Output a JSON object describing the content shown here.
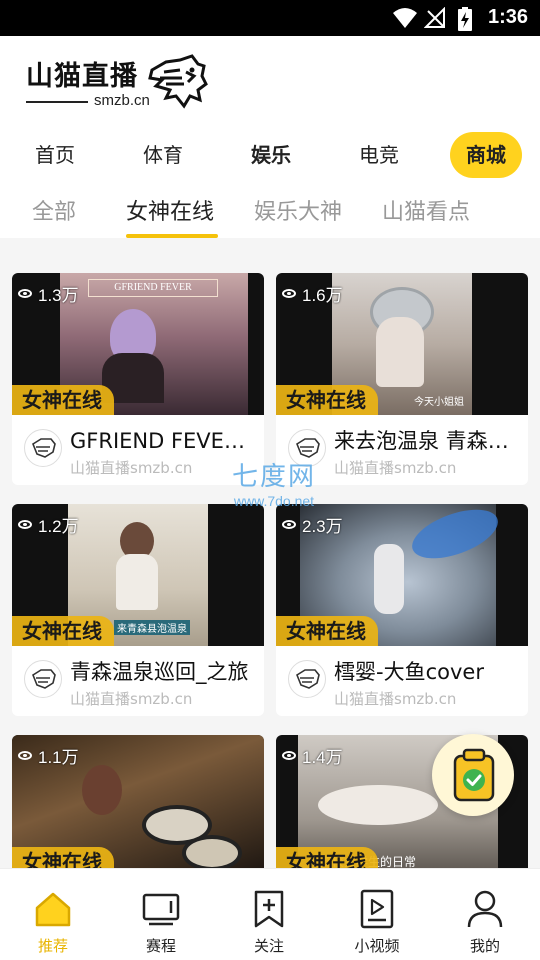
{
  "status_bar": {
    "time": "1:36"
  },
  "header": {
    "logo_cn": "山猫直播",
    "logo_en": "smzb.cn"
  },
  "main_tabs": [
    {
      "label": "首页"
    },
    {
      "label": "体育"
    },
    {
      "label": "娱乐"
    },
    {
      "label": "电竞"
    },
    {
      "label": "商城"
    }
  ],
  "sub_tabs": [
    {
      "label": "全部"
    },
    {
      "label": "女神在线"
    },
    {
      "label": "娱乐大神"
    },
    {
      "label": "山猫看点"
    }
  ],
  "cards": [
    {
      "views": "1.3万",
      "tag": "女神在线",
      "title": "GFRIEND FEVER舞蹈...",
      "author": "山猫直播smzb.cn",
      "thumb_text": "GFRIEND FEVER"
    },
    {
      "views": "1.6万",
      "tag": "女神在线",
      "title": "来去泡温泉 青森温泉",
      "author": "山猫直播smzb.cn",
      "thumb_text": "今天小姐姐"
    },
    {
      "views": "1.2万",
      "tag": "女神在线",
      "title": "青森温泉巡回_之旅",
      "author": "山猫直播smzb.cn",
      "thumb_text": "来青森县泡温泉"
    },
    {
      "views": "2.3万",
      "tag": "女神在线",
      "title": "樰婴-大鱼cover",
      "author": "山猫直播smzb.cn",
      "thumb_text": ""
    },
    {
      "views": "1.1万",
      "tag": "女神在线",
      "title": "",
      "author": "",
      "thumb_text": ""
    },
    {
      "views": "1.4万",
      "tag": "女神在线",
      "title": "",
      "author": "",
      "thumb_text": "本高校女学生的日常"
    }
  ],
  "watermark": {
    "cn": "七度网",
    "en": "www.7do.net"
  },
  "bottom_nav": [
    {
      "label": "推荐"
    },
    {
      "label": "赛程"
    },
    {
      "label": "关注"
    },
    {
      "label": "小视频"
    },
    {
      "label": "我的"
    }
  ],
  "colors": {
    "accent": "#ffd21e",
    "tag": "#ebb414",
    "active_nav": "#e8b400"
  }
}
